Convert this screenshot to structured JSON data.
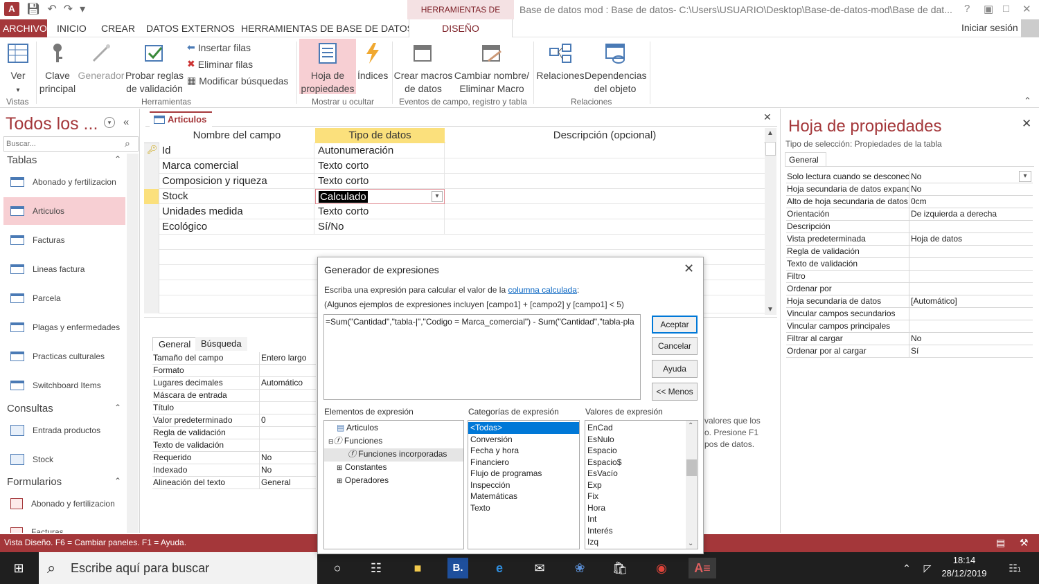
{
  "window": {
    "title": "Base de datos mod : Base de datos- C:\\Users\\USUARIO\\Desktop\\Base-de-datos-mod\\Base de dat...",
    "context_tab_group": "HERRAMIENTAS DE TABLA",
    "help": "?",
    "sign_in": "Iniciar sesión"
  },
  "menu": {
    "file": "ARCHIVO",
    "tabs": [
      "INICIO",
      "CREAR",
      "DATOS EXTERNOS",
      "HERRAMIENTAS DE BASE DE DATOS"
    ],
    "design": "DISEÑO"
  },
  "ribbon": {
    "view": "Ver",
    "primary_key": "Clave principal",
    "builder": "Generador",
    "test_rules": "Probar reglas de validación",
    "insert_rows": "Insertar filas",
    "delete_rows": "Eliminar filas",
    "modify_lookups": "Modificar búsquedas",
    "property_sheet": "Hoja de propiedades",
    "indexes": "Índices",
    "create_macros": "Crear macros de datos",
    "rename_macro": "Cambiar nombre/ Eliminar Macro",
    "relationships": "Relaciones",
    "dependencies": "Dependencias del objeto",
    "groups": {
      "views": "Vistas",
      "tools": "Herramientas",
      "show_hide": "Mostrar u ocultar",
      "events": "Eventos de campo, registro y tabla",
      "relations": "Relaciones"
    }
  },
  "nav": {
    "title": "Todos los ...",
    "search_placeholder": "Buscar...",
    "sections": {
      "tables": "Tablas",
      "queries": "Consultas",
      "forms": "Formularios"
    },
    "tables": [
      "Abonado y fertilizacion",
      "Articulos",
      "Facturas",
      "Lineas factura",
      "Parcela",
      "Plagas y enfermedades",
      "Practicas culturales",
      "Switchboard Items"
    ],
    "queries": [
      "Entrada productos",
      "Stock"
    ],
    "forms": [
      "Abonado y fertilizacion",
      "Facturas"
    ]
  },
  "document": {
    "tab": "Articulos",
    "headers": [
      "Nombre del campo",
      "Tipo de datos",
      "Descripción (opcional)"
    ],
    "rows": [
      {
        "name": "Id",
        "type": "Autonumeración"
      },
      {
        "name": "Marca comercial",
        "type": "Texto corto"
      },
      {
        "name": "Composicion y riqueza",
        "type": "Texto corto"
      },
      {
        "name": "Stock",
        "type": "Calculado"
      },
      {
        "name": "Unidades medida",
        "type": "Texto corto"
      },
      {
        "name": "Ecológico",
        "type": "Sí/No"
      }
    ]
  },
  "field_props": {
    "tabs": [
      "General",
      "Búsqueda"
    ],
    "rows": [
      {
        "k": "Tamaño del campo",
        "v": "Entero largo"
      },
      {
        "k": "Formato",
        "v": ""
      },
      {
        "k": "Lugares decimales",
        "v": "Automático"
      },
      {
        "k": "Máscara de entrada",
        "v": ""
      },
      {
        "k": "Título",
        "v": ""
      },
      {
        "k": "Valor predeterminado",
        "v": "0"
      },
      {
        "k": "Regla de validación",
        "v": ""
      },
      {
        "k": "Texto de validación",
        "v": ""
      },
      {
        "k": "Requerido",
        "v": "No"
      },
      {
        "k": "Indexado",
        "v": "No"
      },
      {
        "k": "Alineación del texto",
        "v": "General"
      }
    ],
    "help_lines": [
      "valores que los",
      "o. Presione F1",
      "pos de datos."
    ]
  },
  "property_sheet": {
    "title": "Hoja de propiedades",
    "selection": "Tipo de selección:  Propiedades de la tabla",
    "tab": "General",
    "rows": [
      {
        "k": "Solo lectura cuando se desconecta",
        "v": "No"
      },
      {
        "k": "Hoja secundaria de datos expandida",
        "v": "No"
      },
      {
        "k": "Alto de hoja secundaria de datos",
        "v": "0cm"
      },
      {
        "k": "Orientación",
        "v": "De izquierda a derecha"
      },
      {
        "k": "Descripción",
        "v": ""
      },
      {
        "k": "Vista predeterminada",
        "v": "Hoja de datos"
      },
      {
        "k": "Regla de validación",
        "v": ""
      },
      {
        "k": "Texto de validación",
        "v": ""
      },
      {
        "k": "Filtro",
        "v": ""
      },
      {
        "k": "Ordenar por",
        "v": ""
      },
      {
        "k": "Hoja secundaria de datos",
        "v": "[Automático]"
      },
      {
        "k": "Vincular campos secundarios",
        "v": ""
      },
      {
        "k": "Vincular campos principales",
        "v": ""
      },
      {
        "k": "Filtrar al cargar",
        "v": "No"
      },
      {
        "k": "Ordenar por al cargar",
        "v": "Sí"
      }
    ]
  },
  "dialog": {
    "title": "Generador de expresiones",
    "instruction_prefix": "Escriba una expresión para calcular el valor de la ",
    "instruction_link": "columna calculada",
    "instruction_suffix": ":",
    "examples": "(Algunos ejemplos de expresiones incluyen [campo1] + [campo2] y [campo1] < 5)",
    "expression": "=Sum(\"Cantidad\",\"tabla-|\",\"Codigo = Marca_comercial\") - Sum(\"Cantidad\",\"tabla-pla",
    "buttons": {
      "ok": "Aceptar",
      "cancel": "Cancelar",
      "help": "Ayuda",
      "less": "<< Menos"
    },
    "elements_label": "Elementos de expresión",
    "categories_label": "Categorías de expresión",
    "values_label": "Valores de expresión",
    "elements": [
      "Articulos",
      "Funciones",
      "Funciones incorporadas",
      "Constantes",
      "Operadores"
    ],
    "categories": [
      "<Todas>",
      "Conversión",
      "Fecha y hora",
      "Financiero",
      "Flujo de programas",
      "Inspección",
      "Matemáticas",
      "Texto"
    ],
    "values": [
      "EnCad",
      "EsNulo",
      "Espacio",
      "Espacio$",
      "EsVacío",
      "Exp",
      "Fix",
      "Hora",
      "Int",
      "Interés",
      "Izq"
    ]
  },
  "status": {
    "text": "Vista Diseño.  F6 = Cambiar paneles.  F1 = Ayuda."
  },
  "taskbar": {
    "search": "Escribe aquí para buscar",
    "time": "18:14",
    "date": "28/12/2019",
    "notif": "1"
  },
  "colors": {
    "accent": "#a4373a",
    "highlight": "#f7cfd3",
    "select": "#0078d7"
  }
}
